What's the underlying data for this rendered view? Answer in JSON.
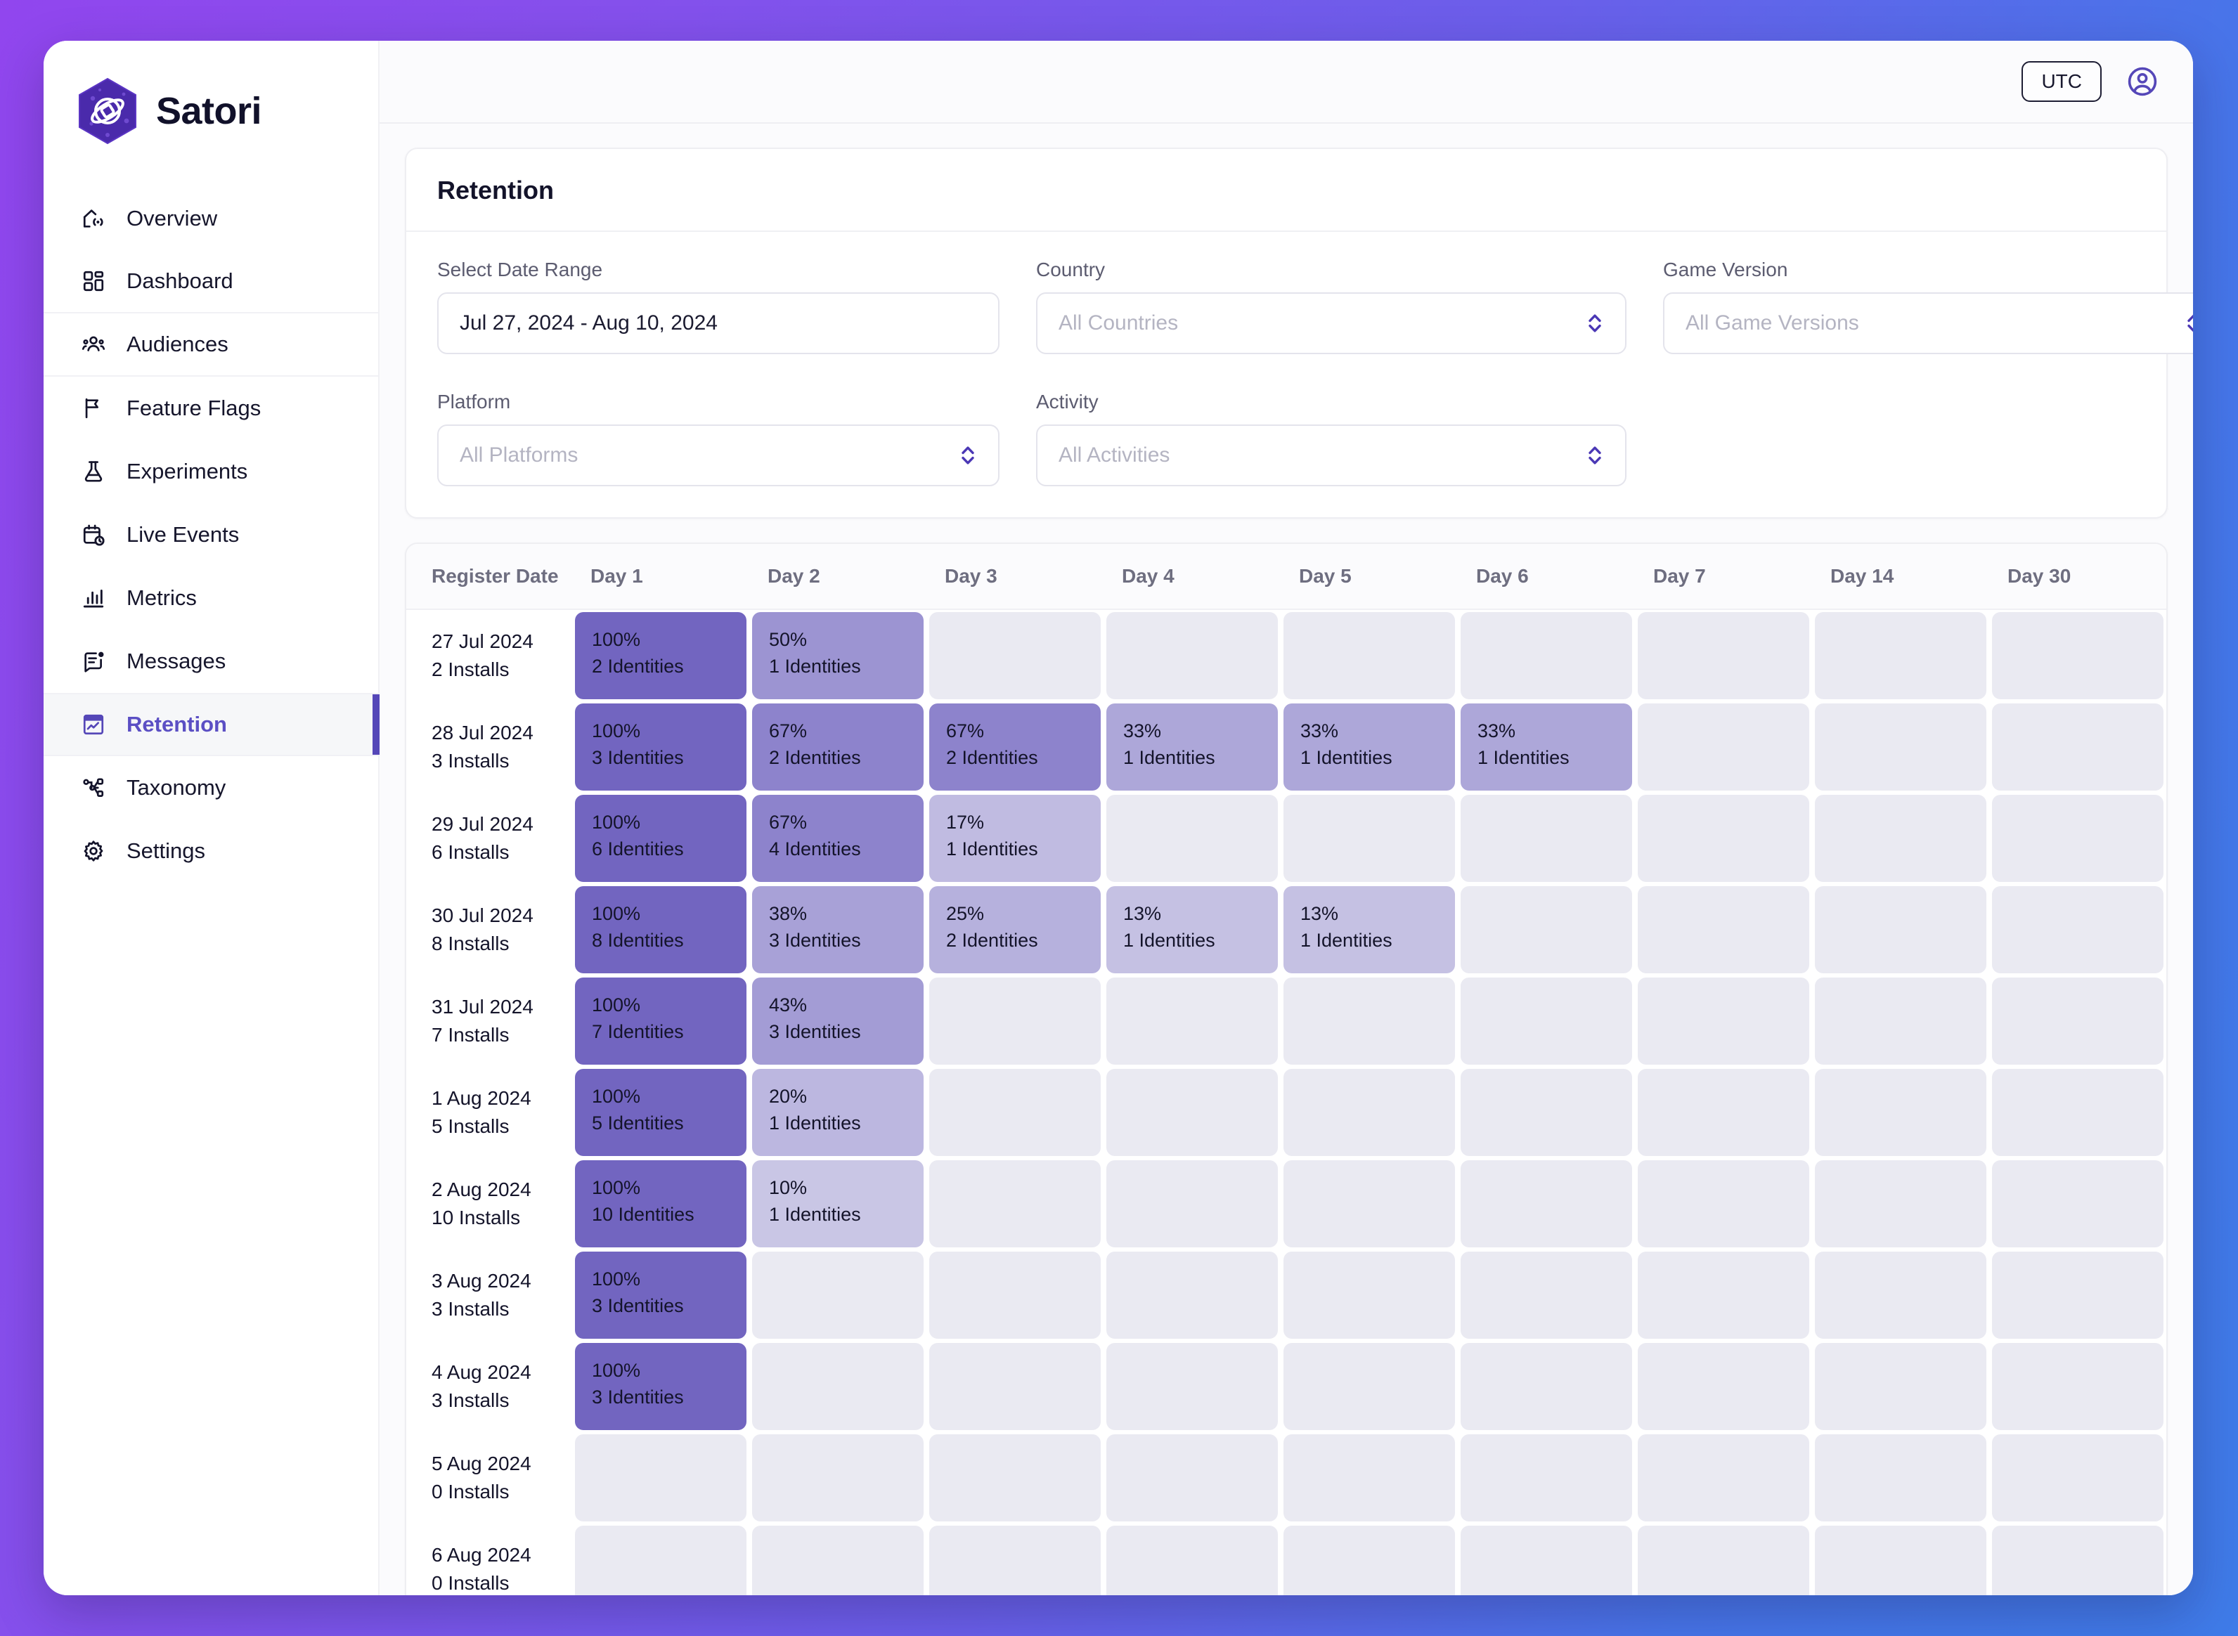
{
  "brand": {
    "name": "Satori",
    "logo_icon": "satori-hexagon-logo"
  },
  "sidebar": {
    "items": [
      {
        "label": "Overview",
        "icon": "home-signal-icon"
      },
      {
        "label": "Dashboard",
        "icon": "dashboard-grid-icon"
      },
      {
        "label": "Audiences",
        "icon": "users-group-icon"
      },
      {
        "label": "Feature Flags",
        "icon": "flag-icon"
      },
      {
        "label": "Experiments",
        "icon": "flask-icon"
      },
      {
        "label": "Live Events",
        "icon": "calendar-clock-icon"
      },
      {
        "label": "Metrics",
        "icon": "bar-chart-icon"
      },
      {
        "label": "Messages",
        "icon": "message-notification-icon"
      },
      {
        "label": "Retention",
        "icon": "retention-chart-icon",
        "active": true
      },
      {
        "label": "Taxonomy",
        "icon": "sitemap-icon"
      },
      {
        "label": "Settings",
        "icon": "gear-icon"
      }
    ]
  },
  "topbar": {
    "timezone_label": "UTC",
    "account_icon": "user-circle-icon"
  },
  "page": {
    "title": "Retention"
  },
  "filters": {
    "date_range": {
      "label": "Select Date Range",
      "value": "Jul 27, 2024 - Aug 10, 2024",
      "placeholder": ""
    },
    "country": {
      "label": "Country",
      "value": "",
      "placeholder": "All Countries"
    },
    "game_version": {
      "label": "Game Version",
      "value": "",
      "placeholder": "All Game Versions"
    },
    "platform": {
      "label": "Platform",
      "value": "",
      "placeholder": "All Platforms"
    },
    "activity": {
      "label": "Activity",
      "value": "",
      "placeholder": "All Activities"
    }
  },
  "colors": {
    "accent": "#5547b8",
    "cell_full": "#7265c0",
    "cell_empty": "#eaeaf2",
    "brand_logo": "#4f2bb0",
    "background_from": "#9146EE",
    "background_to": "#3F7BE8"
  },
  "chart_data": {
    "type": "heatmap",
    "title": "Retention",
    "row_header": "Register Date",
    "columns": [
      "Day 1",
      "Day 2",
      "Day 3",
      "Day 4",
      "Day 5",
      "Day 6",
      "Day 7",
      "Day 14",
      "Day 30"
    ],
    "unit_suffix": "Identities",
    "installs_suffix": "Installs",
    "rows": [
      {
        "date": "27 Jul 2024",
        "installs": 2,
        "installs_label": "2 Installs",
        "cells": [
          {
            "pct": "100%",
            "ids": "2 Identities",
            "v": 100
          },
          {
            "pct": "50%",
            "ids": "1 Identities",
            "v": 50
          },
          null,
          null,
          null,
          null,
          null,
          null,
          null
        ]
      },
      {
        "date": "28 Jul 2024",
        "installs": 3,
        "installs_label": "3 Installs",
        "cells": [
          {
            "pct": "100%",
            "ids": "3 Identities",
            "v": 100
          },
          {
            "pct": "67%",
            "ids": "2 Identities",
            "v": 67
          },
          {
            "pct": "67%",
            "ids": "2 Identities",
            "v": 67
          },
          {
            "pct": "33%",
            "ids": "1 Identities",
            "v": 33
          },
          {
            "pct": "33%",
            "ids": "1 Identities",
            "v": 33
          },
          {
            "pct": "33%",
            "ids": "1 Identities",
            "v": 33
          },
          null,
          null,
          null
        ]
      },
      {
        "date": "29 Jul 2024",
        "installs": 6,
        "installs_label": "6 Installs",
        "cells": [
          {
            "pct": "100%",
            "ids": "6 Identities",
            "v": 100
          },
          {
            "pct": "67%",
            "ids": "4 Identities",
            "v": 67
          },
          {
            "pct": "17%",
            "ids": "1 Identities",
            "v": 17
          },
          null,
          null,
          null,
          null,
          null,
          null
        ]
      },
      {
        "date": "30 Jul 2024",
        "installs": 8,
        "installs_label": "8 Installs",
        "cells": [
          {
            "pct": "100%",
            "ids": "8 Identities",
            "v": 100
          },
          {
            "pct": "38%",
            "ids": "3 Identities",
            "v": 38
          },
          {
            "pct": "25%",
            "ids": "2 Identities",
            "v": 25
          },
          {
            "pct": "13%",
            "ids": "1 Identities",
            "v": 13
          },
          {
            "pct": "13%",
            "ids": "1 Identities",
            "v": 13
          },
          null,
          null,
          null,
          null
        ]
      },
      {
        "date": "31 Jul 2024",
        "installs": 7,
        "installs_label": "7 Installs",
        "cells": [
          {
            "pct": "100%",
            "ids": "7 Identities",
            "v": 100
          },
          {
            "pct": "43%",
            "ids": "3 Identities",
            "v": 43
          },
          null,
          null,
          null,
          null,
          null,
          null,
          null
        ]
      },
      {
        "date": "1 Aug 2024",
        "installs": 5,
        "installs_label": "5 Installs",
        "cells": [
          {
            "pct": "100%",
            "ids": "5 Identities",
            "v": 100
          },
          {
            "pct": "20%",
            "ids": "1 Identities",
            "v": 20
          },
          null,
          null,
          null,
          null,
          null,
          null,
          null
        ]
      },
      {
        "date": "2 Aug 2024",
        "installs": 10,
        "installs_label": "10 Installs",
        "cells": [
          {
            "pct": "100%",
            "ids": "10 Identities",
            "v": 100
          },
          {
            "pct": "10%",
            "ids": "1 Identities",
            "v": 10
          },
          null,
          null,
          null,
          null,
          null,
          null,
          null
        ]
      },
      {
        "date": "3 Aug 2024",
        "installs": 3,
        "installs_label": "3 Installs",
        "cells": [
          {
            "pct": "100%",
            "ids": "3 Identities",
            "v": 100
          },
          null,
          null,
          null,
          null,
          null,
          null,
          null,
          null
        ]
      },
      {
        "date": "4 Aug 2024",
        "installs": 3,
        "installs_label": "3 Installs",
        "cells": [
          {
            "pct": "100%",
            "ids": "3 Identities",
            "v": 100
          },
          null,
          null,
          null,
          null,
          null,
          null,
          null,
          null
        ]
      },
      {
        "date": "5 Aug 2024",
        "installs": 0,
        "installs_label": "0 Installs",
        "cells": [
          null,
          null,
          null,
          null,
          null,
          null,
          null,
          null,
          null
        ]
      },
      {
        "date": "6 Aug 2024",
        "installs": 0,
        "installs_label": "0 Installs",
        "cells": [
          null,
          null,
          null,
          null,
          null,
          null,
          null,
          null,
          null
        ]
      }
    ]
  }
}
